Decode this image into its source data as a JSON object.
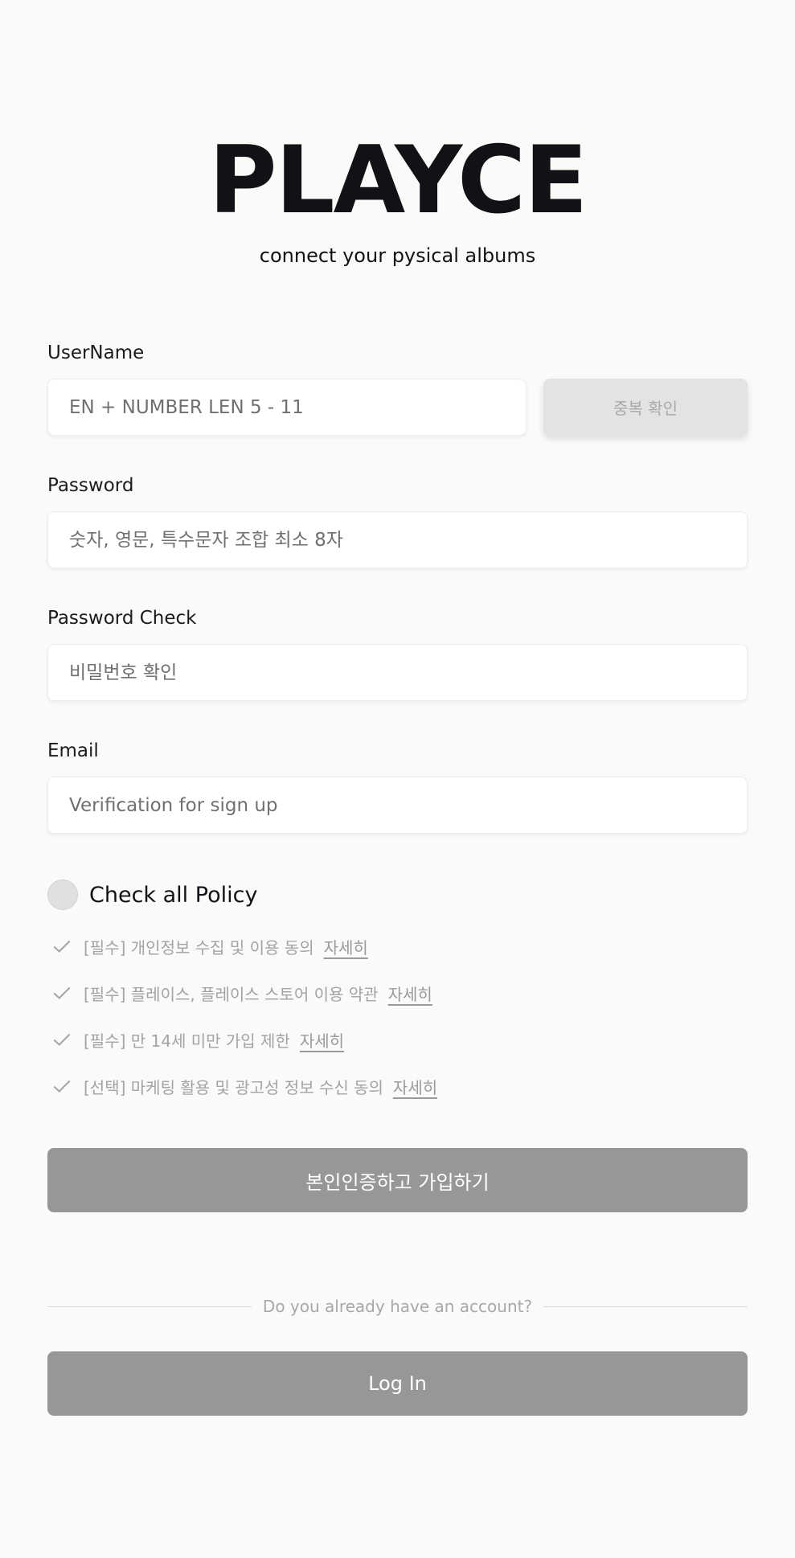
{
  "brand": {
    "logo": "PLAYCE",
    "tagline": "connect your pysical albums"
  },
  "form": {
    "username": {
      "label": "UserName",
      "placeholder": "EN + NUMBER LEN 5 - 11",
      "value": "",
      "check_button": "중복 확인"
    },
    "password": {
      "label": "Password",
      "placeholder": "숫자, 영문, 특수문자 조합 최소 8자",
      "value": ""
    },
    "password_check": {
      "label": "Password Check",
      "placeholder": "비밀번호 확인",
      "value": ""
    },
    "email": {
      "label": "Email",
      "placeholder": "Verification for sign up",
      "value": ""
    }
  },
  "policy": {
    "check_all_label": "Check all Policy",
    "items": [
      {
        "text": "[필수] 개인정보 수집 및 이용 동의",
        "detail": "자세히"
      },
      {
        "text": "[필수] 플레이스, 플레이스 스토어 이용 약관",
        "detail": "자세히"
      },
      {
        "text": "[필수] 만 14세 미만 가입 제한",
        "detail": "자세히"
      },
      {
        "text": "[선택] 마케팅 활용 및 광고성 정보 수신 동의",
        "detail": "자세히"
      }
    ]
  },
  "actions": {
    "signup_button": "본인인증하고 가입하기",
    "divider_text": "Do you already have an account?",
    "login_button": "Log In"
  },
  "colors": {
    "background": "#fafaf8",
    "button_disabled": "#979797",
    "check_button_bg": "#e3e3e3",
    "muted_text": "#a3a3a3"
  }
}
